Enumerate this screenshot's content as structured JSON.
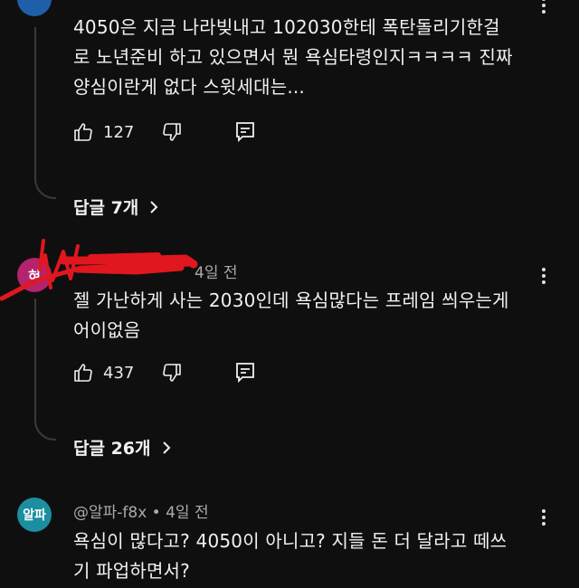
{
  "comments": [
    {
      "text_lines": [
        "4050은 지금 나라빚내고 102030한테 폭탄돌리기한걸",
        "로 노년준비 하고 있으면서 뭔 욕심타령인지ㅋㅋㅋㅋ 진짜",
        "양심이란게 없다 스윗세대는..."
      ],
      "likes": "127",
      "replies_label": "답글 7개"
    },
    {
      "avatar_char": "혀",
      "avatar_color": "#b4236b",
      "time": "4일 전",
      "text_lines": [
        "젤 가난하게 사는 2030인데 욕심많다는 프레임 씌우는게",
        "어이없음"
      ],
      "likes": "437",
      "replies_label": "답글 26개"
    },
    {
      "avatar_char": "알파",
      "avatar_color": "#1b8ea0",
      "handle": "@알파-f8x • 4일 전",
      "text_lines": [
        "욕심이 많다고? 4050이 아니고? 지들 돈 더 달라고 떼쓰",
        "기 파업하면서?"
      ]
    }
  ],
  "colors": {
    "background": "#0f0f0f",
    "redaction_scribble": "#e0171f"
  }
}
